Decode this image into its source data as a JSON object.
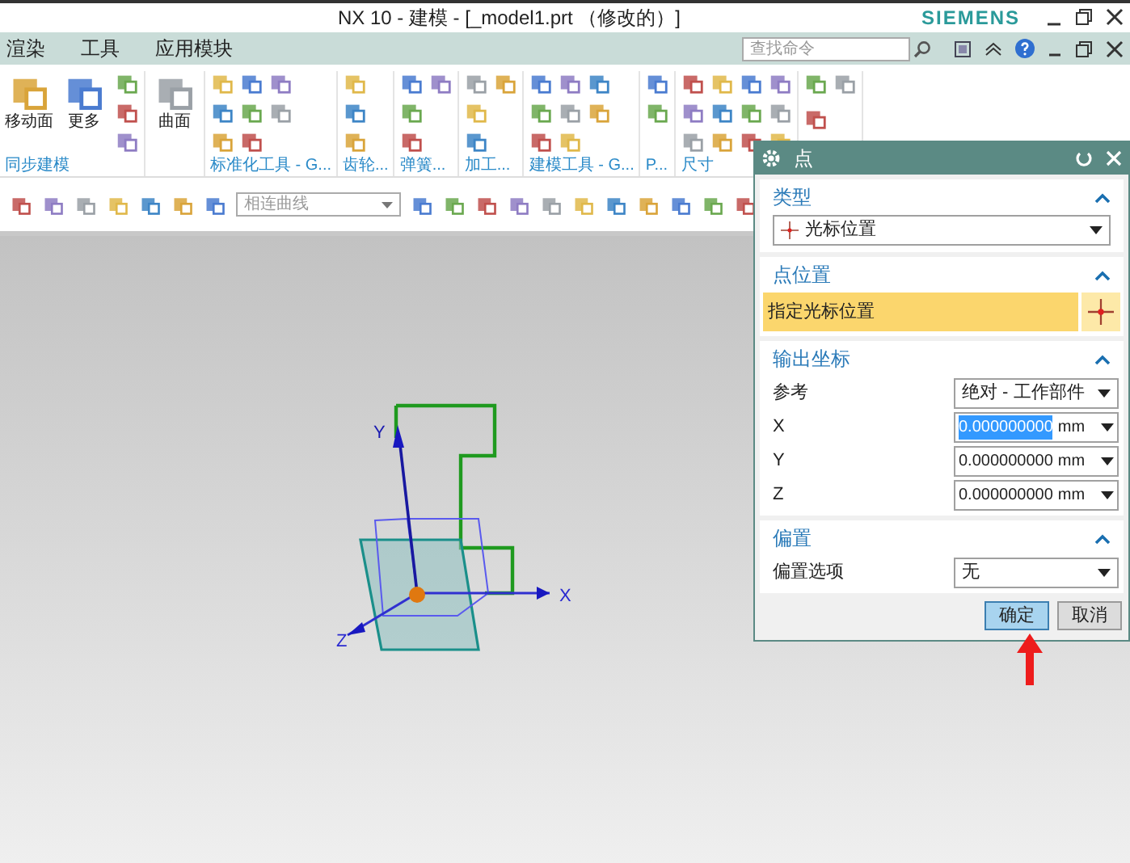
{
  "window": {
    "title": "NX 10 - 建模 - [_model1.prt （修改的）]",
    "brand": "SIEMENS"
  },
  "menu": [
    "渲染",
    "工具",
    "应用模块"
  ],
  "search": {
    "placeholder": "查找命令"
  },
  "ribbon": [
    {
      "label": "同步建模",
      "buttons": [
        "移动面",
        "更多"
      ]
    },
    {
      "buttons": [
        "曲面"
      ]
    },
    {
      "label": "标准化工具 - G..."
    },
    {
      "label": "齿轮..."
    },
    {
      "label": "弹簧..."
    },
    {
      "label": "加工..."
    },
    {
      "label": "建模工具 - G..."
    },
    {
      "label": "P..."
    },
    {
      "label": "尺寸"
    }
  ],
  "toolbar": {
    "filter": "相连曲线"
  },
  "axes": [
    "X",
    "Y",
    "Z"
  ],
  "dialog": {
    "title": "点",
    "type": {
      "title": "类型",
      "expanded": true,
      "value": "光标位置"
    },
    "location": {
      "title": "点位置",
      "expanded": true,
      "label": "指定光标位置"
    },
    "output": {
      "title": "输出坐标",
      "expanded": true,
      "reference_label": "参考",
      "reference": "绝对 - 工作部件",
      "coords": [
        {
          "label": "X",
          "value": "0.000000000",
          "unit": "mm",
          "selected": true
        },
        {
          "label": "Y",
          "value": "0.000000000",
          "unit": "mm",
          "selected": false
        },
        {
          "label": "Z",
          "value": "0.000000000",
          "unit": "mm",
          "selected": false
        }
      ]
    },
    "offset": {
      "title": "偏置",
      "expanded": true,
      "label": "偏置选项",
      "value": "无"
    },
    "buttons": [
      {
        "label": "确定",
        "selected": true
      },
      {
        "label": "取消",
        "selected": false
      }
    ]
  }
}
